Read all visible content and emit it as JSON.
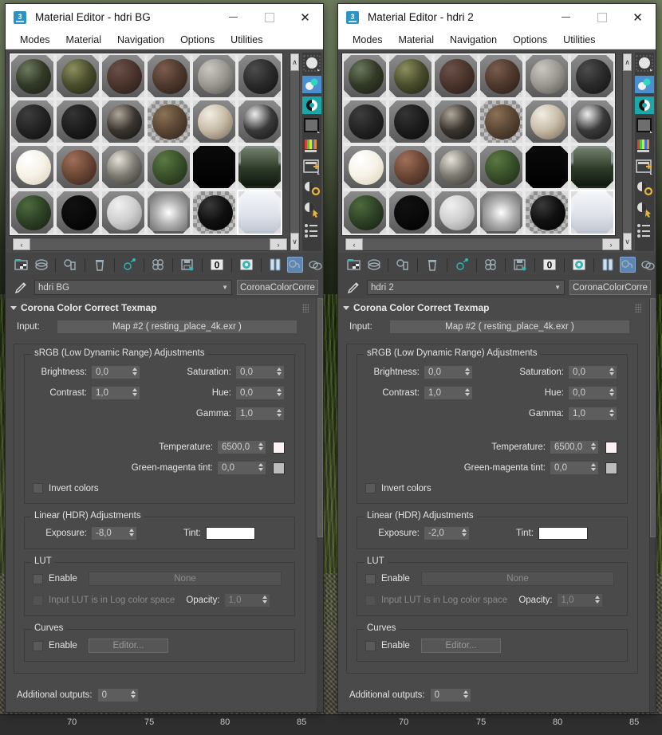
{
  "background": {
    "ruler_ticks_left": [
      "70",
      "75",
      "80",
      "85"
    ],
    "ruler_ticks_right": [
      "70",
      "75",
      "80",
      "85"
    ]
  },
  "windows": [
    {
      "id": "left",
      "title": "Material Editor - hdri BG",
      "app_icon_label": "3",
      "window_buttons": {
        "minimize": "—",
        "maximize": "☐",
        "close": "✕"
      },
      "menu": [
        "Modes",
        "Material",
        "Navigation",
        "Options",
        "Utilities"
      ],
      "slot_nav": {
        "up": "∧",
        "down": "∨",
        "left": "‹",
        "right": "›"
      },
      "material_name": "hdri BG",
      "material_type": "CoronaColorCorre",
      "rollout_title": "Corona Color Correct Texmap",
      "input_label": "Input:",
      "input_value": "Map #2 ( resting_place_4k.exr )",
      "srgb_group_title": "sRGB (Low Dynamic Range) Adjustments",
      "brightness_label": "Brightness:",
      "brightness_value": "0,0",
      "contrast_label": "Contrast:",
      "contrast_value": "1,0",
      "saturation_label": "Saturation:",
      "saturation_value": "0,0",
      "hue_label": "Hue:",
      "hue_value": "0,0",
      "gamma_label": "Gamma:",
      "gamma_value": "1,0",
      "temperature_label": "Temperature:",
      "temperature_value": "6500,0",
      "temperature_swatch": "#fdf2f2",
      "tint_label": "Green-magenta tint:",
      "tint_value": "0,0",
      "tint_swatch": "#bcbcbc",
      "invert_label": "Invert colors",
      "hdr_group_title": "Linear (HDR) Adjustments",
      "exposure_label": "Exposure:",
      "exposure_value": "-8,0",
      "hdr_tint_label": "Tint:",
      "hdr_tint_swatch": "#ffffff",
      "lut_group_title": "LUT",
      "lut_enable_label": "Enable",
      "lut_none_label": "None",
      "lut_log_label": "Input LUT is in Log color space",
      "lut_opacity_label": "Opacity:",
      "lut_opacity_value": "1,0",
      "curves_group_title": "Curves",
      "curves_enable_label": "Enable",
      "curves_editor_label": "Editor...",
      "additional_outputs_label": "Additional outputs:",
      "additional_outputs_value": "0"
    },
    {
      "id": "right",
      "title": "Material Editor - hdri 2",
      "app_icon_label": "3",
      "window_buttons": {
        "minimize": "—",
        "maximize": "☐",
        "close": "✕"
      },
      "menu": [
        "Modes",
        "Material",
        "Navigation",
        "Options",
        "Utilities"
      ],
      "slot_nav": {
        "up": "∧",
        "down": "∨",
        "left": "‹",
        "right": "›"
      },
      "material_name": "hdri 2",
      "material_type": "CoronaColorCorre",
      "rollout_title": "Corona Color Correct Texmap",
      "input_label": "Input:",
      "input_value": "Map #2 ( resting_place_4k.exr )",
      "srgb_group_title": "sRGB (Low Dynamic Range) Adjustments",
      "brightness_label": "Brightness:",
      "brightness_value": "0,0",
      "contrast_label": "Contrast:",
      "contrast_value": "1,0",
      "saturation_label": "Saturation:",
      "saturation_value": "0,0",
      "hue_label": "Hue:",
      "hue_value": "0,0",
      "gamma_label": "Gamma:",
      "gamma_value": "1,0",
      "temperature_label": "Temperature:",
      "temperature_value": "6500,0",
      "temperature_swatch": "#fdf2f2",
      "tint_label": "Green-magenta tint:",
      "tint_value": "0,0",
      "tint_swatch": "#bcbcbc",
      "invert_label": "Invert colors",
      "hdr_group_title": "Linear (HDR) Adjustments",
      "exposure_label": "Exposure:",
      "exposure_value": "-2,0",
      "hdr_tint_label": "Tint:",
      "hdr_tint_swatch": "#ffffff",
      "lut_group_title": "LUT",
      "lut_enable_label": "Enable",
      "lut_none_label": "None",
      "lut_log_label": "Input LUT is in Log color space",
      "lut_opacity_label": "Opacity:",
      "lut_opacity_value": "1,0",
      "curves_group_title": "Curves",
      "curves_enable_label": "Enable",
      "curves_editor_label": "Editor...",
      "additional_outputs_label": "Additional outputs:",
      "additional_outputs_value": "0"
    }
  ],
  "material_slots": [
    {
      "name": "slot-1",
      "kind": "sphere",
      "colors": [
        "#6d7a5e",
        "#323a27",
        "#171c12"
      ],
      "bg": "plain",
      "selected": false
    },
    {
      "name": "slot-2",
      "kind": "sphere",
      "colors": [
        "#8b8f5e",
        "#4a4d2c",
        "#1d2011"
      ],
      "bg": "plain",
      "selected": false
    },
    {
      "name": "slot-3",
      "kind": "sphere",
      "colors": [
        "#6b5149",
        "#4a342c",
        "#241814"
      ],
      "bg": "plain",
      "selected": false
    },
    {
      "name": "slot-4",
      "kind": "sphere",
      "colors": [
        "#7a5e4e",
        "#4e382c",
        "#281c15"
      ],
      "bg": "plain",
      "selected": false
    },
    {
      "name": "slot-5",
      "kind": "sphere",
      "colors": [
        "#c9c7c0",
        "#9b9891",
        "#55534e"
      ],
      "bg": "plain",
      "selected": false
    },
    {
      "name": "slot-6",
      "kind": "sphere",
      "colors": [
        "#4d4d4d",
        "#2a2a2a",
        "#101010"
      ],
      "bg": "plain",
      "selected": false
    },
    {
      "name": "slot-7",
      "kind": "sphere",
      "colors": [
        "#3e3e3e",
        "#232323",
        "#0c0c0c"
      ],
      "bg": "plain",
      "selected": false
    },
    {
      "name": "slot-8",
      "kind": "sphere",
      "colors": [
        "#343434",
        "#1c1c1c",
        "#090909"
      ],
      "bg": "plain",
      "selected": false
    },
    {
      "name": "slot-9",
      "kind": "sphere",
      "colors": [
        "#b0a79a",
        "#3a3530",
        "#0e0e0e"
      ],
      "bg": "plain",
      "selected": false
    },
    {
      "name": "slot-10",
      "kind": "sphere",
      "colors": [
        "#8b7258",
        "#5a4634",
        "#2b2119"
      ],
      "bg": "checker",
      "selected": false
    },
    {
      "name": "slot-11",
      "kind": "sphere",
      "colors": [
        "#f2eee4",
        "#c7bba6",
        "#6e6354"
      ],
      "bg": "plain",
      "selected": false
    },
    {
      "name": "slot-12",
      "kind": "sphere",
      "colors": [
        "#ededed",
        "#3a3a3a",
        "#111111"
      ],
      "bg": "plain",
      "selected": false
    },
    {
      "name": "slot-13",
      "kind": "sphere",
      "colors": [
        "#ffffff",
        "#f6f2e6",
        "#d8cfb6"
      ],
      "bg": "plain",
      "selected": false
    },
    {
      "name": "slot-14",
      "kind": "sphere",
      "colors": [
        "#a0705a",
        "#6b4634",
        "#33201a"
      ],
      "bg": "plain",
      "selected": false
    },
    {
      "name": "slot-15",
      "kind": "sphere",
      "colors": [
        "#e6e2d8",
        "#7d7a72",
        "#2e2c28"
      ],
      "bg": "plain",
      "selected": false
    },
    {
      "name": "slot-16",
      "kind": "sphere",
      "colors": [
        "#5c7a42",
        "#39502a",
        "#1b2613"
      ],
      "bg": "plain",
      "selected": false
    },
    {
      "name": "slot-17",
      "kind": "flat",
      "colors": [
        "#0a0a0a",
        "#050505",
        "#000000"
      ],
      "bg": "dark-env",
      "selected": false
    },
    {
      "name": "slot-18",
      "kind": "flat",
      "colors": [
        "#6f7f6a",
        "#2e3a28",
        "#101810"
      ],
      "bg": "grass-env",
      "selected": false
    },
    {
      "name": "slot-19",
      "kind": "sphere",
      "colors": [
        "#4e6b3e",
        "#2e4226",
        "#141c10"
      ],
      "bg": "plain",
      "selected": false
    },
    {
      "name": "slot-20",
      "kind": "sphere",
      "colors": [
        "#111111",
        "#0a0a0a",
        "#000000"
      ],
      "bg": "plain",
      "selected": false
    },
    {
      "name": "slot-21",
      "kind": "sphere",
      "colors": [
        "#f0f0f0",
        "#cfcfcf",
        "#8e8e8e"
      ],
      "bg": "plain",
      "selected": false
    },
    {
      "name": "slot-22",
      "kind": "gradient",
      "colors": [
        "#ffffff",
        "#b4b4b4",
        "#6a6a6a"
      ],
      "bg": "plain",
      "selected": false
    },
    {
      "name": "slot-23",
      "kind": "sphere",
      "colors": [
        "#3a3a3a",
        "#101010",
        "#000000"
      ],
      "bg": "checker",
      "selected": false
    },
    {
      "name": "slot-24",
      "kind": "flat",
      "colors": [
        "#f2f4f8",
        "#dfe3ea",
        "#c3c9d4"
      ],
      "bg": "sky-env",
      "selected": true
    }
  ],
  "slot_toolbar_icons": [
    {
      "name": "get-material-icon",
      "glyph": "▤"
    },
    {
      "name": "put-material-to-scene-icon",
      "glyph": "◎"
    },
    {
      "name": "assign-material-to-selection-icon",
      "glyph": "◑"
    },
    {
      "name": "delete-material-icon",
      "glyph": "Ὕ1"
    },
    {
      "name": "reset-map-icon",
      "glyph": "↻"
    },
    {
      "name": "make-material-copy-icon",
      "glyph": "❖"
    },
    {
      "name": "put-to-library-icon",
      "glyph": "ὋE"
    },
    {
      "name": "material-id-channel-icon",
      "glyph": "0"
    },
    {
      "name": "show-shaded-material-in-viewport-icon",
      "glyph": "◉"
    },
    {
      "name": "show-end-result-icon",
      "glyph": "⫼"
    },
    {
      "name": "go-to-parent-icon",
      "glyph": "⬆"
    },
    {
      "name": "go-forward-to-sibling-icon",
      "glyph": "➡"
    }
  ],
  "side_toolbar_icons": [
    {
      "name": "sample-type-sphere-icon"
    },
    {
      "name": "backlight-icon"
    },
    {
      "name": "background-checker-icon"
    },
    {
      "name": "sample-uv-tiling-icon"
    },
    {
      "name": "video-color-check-icon"
    },
    {
      "name": "make-preview-icon"
    },
    {
      "name": "options-icon"
    },
    {
      "name": "select-by-material-icon"
    },
    {
      "name": "material-map-navigator-icon"
    }
  ]
}
